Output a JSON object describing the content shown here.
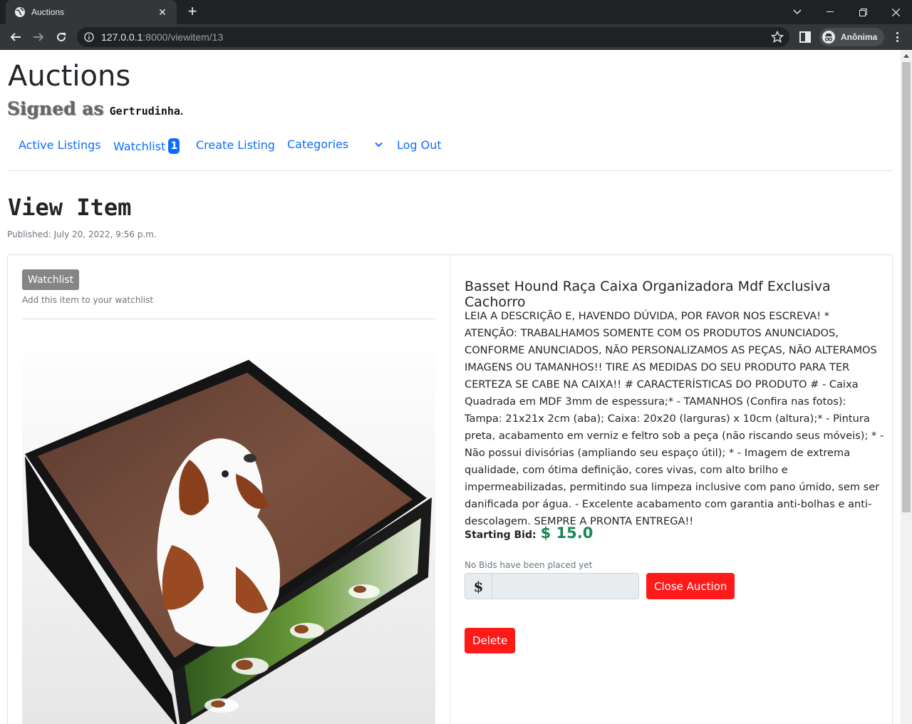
{
  "browser": {
    "tab_title": "Auctions",
    "url_host": "127.0.0.1",
    "url_path": ":8000/viewitem/13",
    "profile_label": "Anônima"
  },
  "site": {
    "title": "Auctions",
    "signed_label": "Signed as",
    "username": "Gertrudinha",
    "signed_suffix": "."
  },
  "nav": {
    "active_listings": "Active Listings",
    "watchlist": "Watchlist",
    "watchlist_count": "1",
    "create_listing": "Create Listing",
    "categories": "Categories",
    "logout": "Log Out"
  },
  "page": {
    "heading": "View Item",
    "published": "Published: July 20, 2022, 9:56 p.m."
  },
  "item": {
    "watchlist_button": "Watchlist",
    "watchlist_help": "Add this item to your watchlist",
    "image_alt": "Basset hound printed organizer box",
    "title": "Basset Hound Raça Caixa Organizadora Mdf Exclusiva Cachorro",
    "description": "LEIA A DESCRIÇÃO E, HAVENDO DÚVIDA, POR FAVOR NOS ESCREVA! * ATENÇÃO: TRABALHAMOS SOMENTE COM OS PRODUTOS ANUNCIADOS, CONFORME ANUNCIADOS, NÃO PERSONALIZAMOS AS PEÇAS, NÃO ALTERAMOS IMAGENS OU TAMANHOS!! TIRE AS MEDIDAS DO SEU PRODUTO PARA TER CERTEZA SE CABE NA CAIXA!! # CARACTERÍSTICAS DO PRODUTO # - Caixa Quadrada em MDF 3mm de espessura;* - TAMANHOS (Confira nas fotos): Tampa: 21x21x 2cm (aba); Caixa: 20x20 (larguras) x 10cm (altura);* - Pintura preta, acabamento em verniz e feltro sob a peça (não riscando seus móveis); * - Não possui divisórias (ampliando seu espaço útil); * - Imagem de extrema qualidade, com ótima definição, cores vivas, com alto brilho e impermeabilizadas, permitindo sua limpeza inclusive com pano úmido, sem ser danificada por água. - Excelente acabamento com garantia anti-bolhas e anti-descolagem. SEMPRE A PRONTA ENTREGA!!",
    "starting_bid_label": "Starting Bid:",
    "starting_bid_value": "$ 15.0",
    "no_bids": "No Bids have been placed yet",
    "currency_symbol": "$",
    "bid_value": "",
    "close_auction": "Close Auction",
    "delete": "Delete"
  },
  "colors": {
    "link": "#0d6efd",
    "danger": "#ff1a1a",
    "price": "#198754",
    "watchlist_button": "#858585"
  }
}
